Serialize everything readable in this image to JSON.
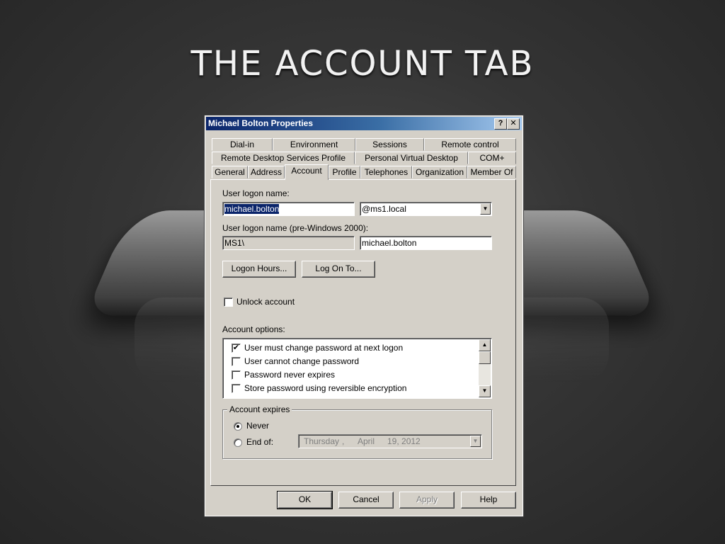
{
  "slide": {
    "title": "THE ACCOUNT TAB"
  },
  "dialog": {
    "title": "Michael Bolton Properties",
    "help_btn": "?",
    "close_btn": "✕",
    "tabs_row1": [
      "Dial-in",
      "Environment",
      "Sessions",
      "Remote control"
    ],
    "tabs_row2": [
      "Remote Desktop Services Profile",
      "Personal Virtual Desktop",
      "COM+"
    ],
    "tabs_row3": [
      "General",
      "Address",
      "Account",
      "Profile",
      "Telephones",
      "Organization",
      "Member Of"
    ],
    "active_tab": "Account"
  },
  "account": {
    "logon_label": "User logon name:",
    "logon_name": "michael.bolton",
    "domain_suffix": "@ms1.local",
    "pre2000_label": "User logon name (pre-Windows 2000):",
    "pre2000_domain": "MS1\\",
    "pre2000_name": "michael.bolton",
    "logon_hours_btn": "Logon Hours...",
    "log_on_to_btn": "Log On To...",
    "unlock_label": "Unlock account",
    "unlock_checked": false,
    "options_label": "Account options:",
    "options": [
      {
        "label": "User must change password at next logon",
        "checked": true
      },
      {
        "label": "User cannot change password",
        "checked": false
      },
      {
        "label": "Password never expires",
        "checked": false
      },
      {
        "label": "Store password using reversible encryption",
        "checked": false
      }
    ],
    "expires": {
      "legend": "Account expires",
      "never_label": "Never",
      "never_selected": true,
      "endof_label": "End of:",
      "date_day": "Thursday",
      "date_sep": ",",
      "date_month": "April",
      "date_rest": "19, 2012"
    }
  },
  "footer": {
    "ok": "OK",
    "cancel": "Cancel",
    "apply": "Apply",
    "help": "Help"
  },
  "icons": {
    "check": "✔",
    "arrow_down": "▼",
    "arrow_up": "▲"
  }
}
